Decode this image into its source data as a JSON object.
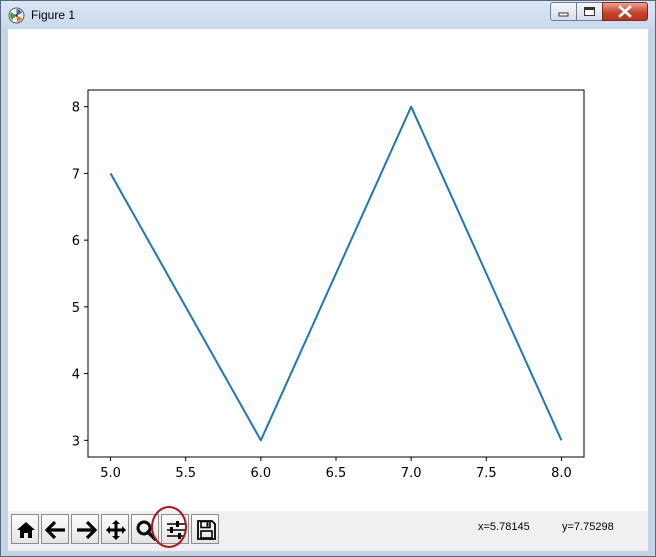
{
  "window": {
    "title": "Figure 1"
  },
  "toolbar": {
    "buttons": [
      {
        "name": "home",
        "icon": "home-icon"
      },
      {
        "name": "back",
        "icon": "arrow-left-icon"
      },
      {
        "name": "forward",
        "icon": "arrow-right-icon"
      },
      {
        "name": "pan",
        "icon": "move-icon"
      },
      {
        "name": "zoom",
        "icon": "magnifier-icon"
      },
      {
        "name": "configure-subplots",
        "icon": "sliders-icon"
      },
      {
        "name": "save",
        "icon": "floppy-disk-icon"
      }
    ]
  },
  "status": {
    "x_readout": "x=5.78145",
    "y_readout": "y=7.75298"
  },
  "colors": {
    "line": "#1f77b4",
    "highlight": "#b0141c"
  },
  "chart_data": {
    "type": "line",
    "x": [
      5,
      6,
      7,
      8
    ],
    "y": [
      7,
      3,
      8,
      3
    ],
    "xlim": [
      4.85,
      8.15
    ],
    "ylim": [
      2.75,
      8.25
    ],
    "xticks": [
      5.0,
      5.5,
      6.0,
      6.5,
      7.0,
      7.5,
      8.0
    ],
    "xtick_labels": [
      "5.0",
      "5.5",
      "6.0",
      "6.5",
      "7.0",
      "7.5",
      "8.0"
    ],
    "yticks": [
      3,
      4,
      5,
      6,
      7,
      8
    ],
    "ytick_labels": [
      "3",
      "4",
      "5",
      "6",
      "7",
      "8"
    ],
    "title": "",
    "xlabel": "",
    "ylabel": "",
    "grid": false
  }
}
